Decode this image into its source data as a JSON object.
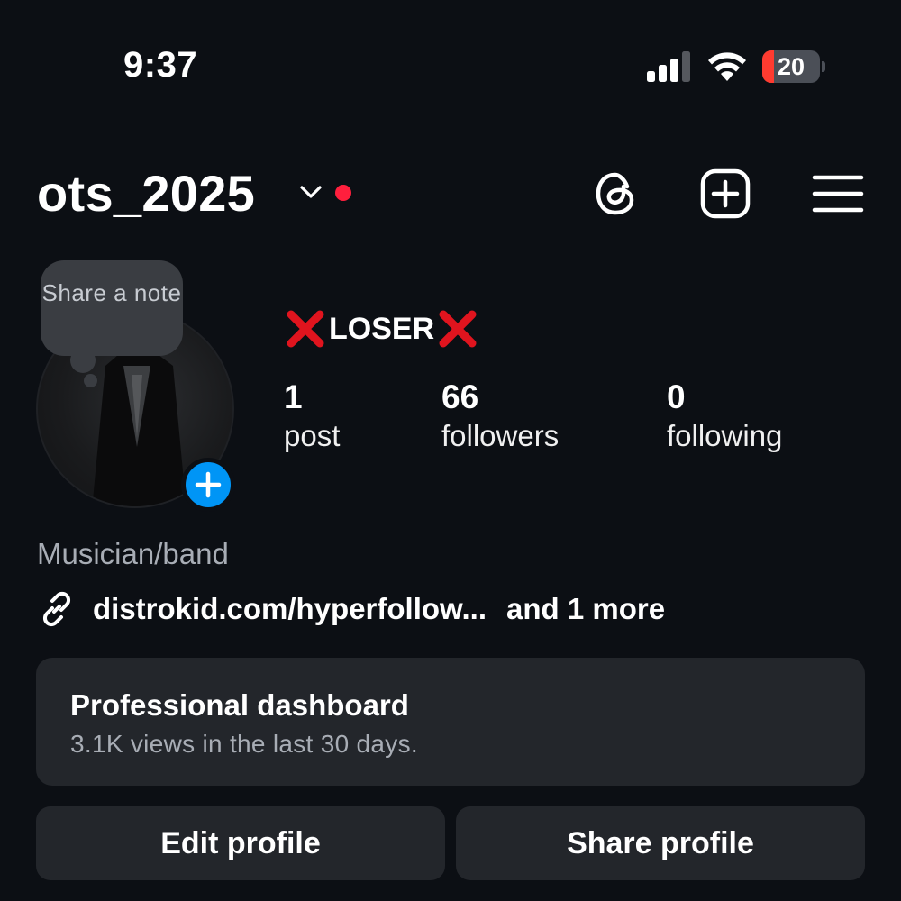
{
  "status_bar": {
    "time": "9:37",
    "battery_level": "20",
    "battery_fraction": 0.2,
    "icons": [
      "signal-icon",
      "wifi-icon",
      "battery-icon"
    ]
  },
  "header": {
    "username": "ots_2025",
    "icons": [
      "chevron-down-icon",
      "notification-dot",
      "threads-icon",
      "create-plus-icon",
      "menu-icon"
    ]
  },
  "profile": {
    "note_placeholder": "Share a note",
    "display_name": "LOSER",
    "display_name_decoration": "x-mark-emoji",
    "stats": {
      "posts": {
        "value": "1",
        "label": "post"
      },
      "followers": {
        "value": "66",
        "label": "followers"
      },
      "following": {
        "value": "0",
        "label": "following"
      }
    },
    "category": "Musician/band",
    "link": "distrokid.com/hyperfollow...",
    "link_more": "and 1 more"
  },
  "dashboard": {
    "title": "Professional dashboard",
    "subtitle": "3.1K views in the last 30 days."
  },
  "buttons": {
    "edit": "Edit profile",
    "share": "Share profile"
  },
  "colors": {
    "background": "#0c0f14",
    "surface": "#23262b",
    "accent_blue": "#0095f6",
    "red": "#ff1f3d",
    "muted_text": "#a8adb5"
  }
}
